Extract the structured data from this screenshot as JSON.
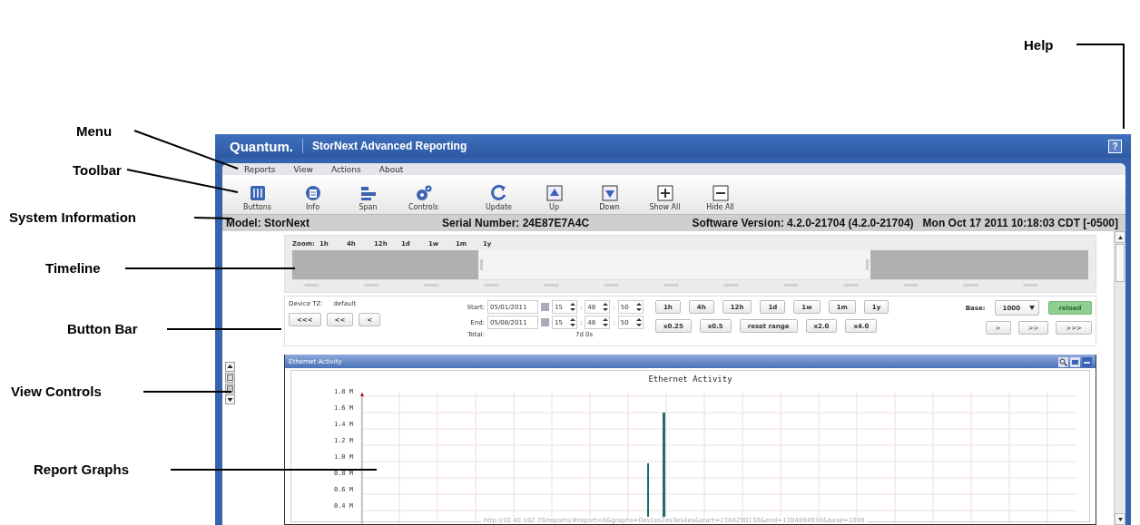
{
  "callouts": [
    {
      "label": "Help"
    },
    {
      "label": "Menu"
    },
    {
      "label": "Toolbar"
    },
    {
      "label": "System Information"
    },
    {
      "label": "Timeline"
    },
    {
      "label": "Button Bar"
    },
    {
      "label": "View Controls"
    },
    {
      "label": "Report Graphs"
    }
  ],
  "window": {
    "brand": "Quantum.",
    "title": "StorNext Advanced Reporting",
    "help_icon": "?"
  },
  "menu": [
    "Reports",
    "View",
    "Actions",
    "About"
  ],
  "toolbar": [
    {
      "label": "Buttons",
      "kind": "buttons"
    },
    {
      "label": "Info",
      "kind": "info"
    },
    {
      "label": "Span",
      "kind": "span"
    },
    {
      "label": "Controls",
      "kind": "controls"
    },
    {
      "label": "Update",
      "kind": "update"
    },
    {
      "label": "Up",
      "kind": "up"
    },
    {
      "label": "Down",
      "kind": "down"
    },
    {
      "label": "Show All",
      "kind": "plus"
    },
    {
      "label": "Hide All",
      "kind": "minus"
    }
  ],
  "system_info": {
    "model": "Model: StorNext",
    "serial": "Serial Number: 24E87E7A4C",
    "software": "Software Version: 4.2.0-21704 (4.2.0-21704)",
    "datetime": "Mon Oct 17 2011 10:18:03 CDT [-0500]"
  },
  "timeline": {
    "zoom_label": "Zoom:",
    "zoom_options": [
      "1h",
      "4h",
      "12h",
      "1d",
      "1w",
      "1m",
      "1y"
    ]
  },
  "button_bar": {
    "device_tz_label": "Device TZ:",
    "device_tz": "default",
    "back_buttons": [
      "<<<",
      "<<",
      "<"
    ],
    "start_label": "Start:",
    "start_date": "05/01/2011",
    "time_separator": ":",
    "start_time": [
      "15",
      "48",
      "50"
    ],
    "end_label": "End:",
    "end_date": "05/08/2011",
    "end_time": [
      "15",
      "48",
      "50"
    ],
    "total_label": "Total:",
    "total": "7d 0s",
    "range_buttons": [
      "1h",
      "4h",
      "12h",
      "1d",
      "1w",
      "1m",
      "1y"
    ],
    "scale_buttons": [
      "x0.25",
      "x0.5",
      "reset range",
      "x2.0",
      "x4.0"
    ],
    "base_label": "Base:",
    "base": "1000",
    "reload": "reload",
    "forward_buttons": [
      ">",
      ">>",
      ">>>"
    ]
  },
  "report": {
    "title": "Ethernet Activity",
    "chart_title": "Ethernet Activity",
    "y_labels": [
      "1.8 M",
      "1.6 M",
      "1.4 M",
      "1.2 M",
      "1.0 M",
      "0.8 M",
      "0.6 M",
      "0.4 M"
    ]
  },
  "status_url": "http://10.40.162.70/reports/#report=0&graphs=0es1es2es3es4es&start=1304290130&end=1304894930&base=1000"
}
